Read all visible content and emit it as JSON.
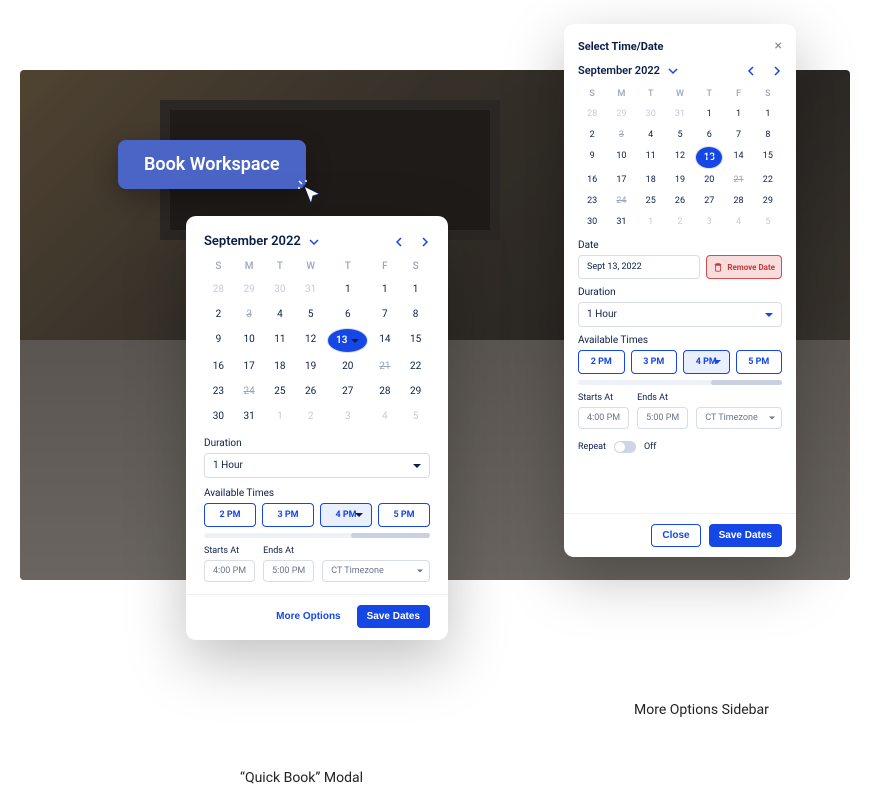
{
  "cta": {
    "label": "Book Workspace"
  },
  "calendar": {
    "month_label": "September 2022",
    "dow": [
      "S",
      "M",
      "T",
      "W",
      "T",
      "F",
      "S"
    ],
    "days": [
      {
        "n": "28",
        "cls": "muted"
      },
      {
        "n": "29",
        "cls": "muted"
      },
      {
        "n": "30",
        "cls": "muted"
      },
      {
        "n": "31",
        "cls": "muted"
      },
      {
        "n": "1",
        "cls": ""
      },
      {
        "n": "1",
        "cls": ""
      },
      {
        "n": "1",
        "cls": ""
      },
      {
        "n": "2",
        "cls": ""
      },
      {
        "n": "3",
        "cls": "strike"
      },
      {
        "n": "4",
        "cls": ""
      },
      {
        "n": "5",
        "cls": ""
      },
      {
        "n": "6",
        "cls": ""
      },
      {
        "n": "7",
        "cls": ""
      },
      {
        "n": "8",
        "cls": ""
      },
      {
        "n": "9",
        "cls": ""
      },
      {
        "n": "10",
        "cls": ""
      },
      {
        "n": "11",
        "cls": ""
      },
      {
        "n": "12",
        "cls": ""
      },
      {
        "n": "13",
        "cls": "sel"
      },
      {
        "n": "14",
        "cls": ""
      },
      {
        "n": "15",
        "cls": ""
      },
      {
        "n": "16",
        "cls": ""
      },
      {
        "n": "17",
        "cls": ""
      },
      {
        "n": "18",
        "cls": ""
      },
      {
        "n": "19",
        "cls": ""
      },
      {
        "n": "20",
        "cls": ""
      },
      {
        "n": "21",
        "cls": "strike"
      },
      {
        "n": "22",
        "cls": ""
      },
      {
        "n": "23",
        "cls": ""
      },
      {
        "n": "24",
        "cls": "strike"
      },
      {
        "n": "25",
        "cls": ""
      },
      {
        "n": "26",
        "cls": ""
      },
      {
        "n": "27",
        "cls": ""
      },
      {
        "n": "28",
        "cls": ""
      },
      {
        "n": "29",
        "cls": ""
      },
      {
        "n": "30",
        "cls": ""
      },
      {
        "n": "31",
        "cls": ""
      },
      {
        "n": "1",
        "cls": "muted"
      },
      {
        "n": "2",
        "cls": "muted"
      },
      {
        "n": "3",
        "cls": "muted"
      },
      {
        "n": "4",
        "cls": "muted"
      },
      {
        "n": "5",
        "cls": "muted"
      }
    ]
  },
  "modal": {
    "duration_label": "Duration",
    "duration_value": "1 Hour",
    "avail_label": "Available Times",
    "times": [
      "2 PM",
      "3 PM",
      "4 PM",
      "5 PM"
    ],
    "times_selected_index": 2,
    "starts_label": "Starts At",
    "ends_label": "Ends At",
    "starts_value": "4:00 PM",
    "ends_value": "5:00 PM",
    "tz_value": "CT Timezone",
    "more_label": "More Options",
    "save_label": "Save Dates"
  },
  "sidebar": {
    "title": "Select Time/Date",
    "date_label": "Date",
    "date_value": "Sept 13, 2022",
    "remove_label": "Remove Date",
    "duration_label": "Duration",
    "duration_value": "1 Hour",
    "avail_label": "Available Times",
    "times": [
      "2 PM",
      "3 PM",
      "4 PM",
      "5 PM"
    ],
    "times_selected_index": 2,
    "starts_label": "Starts At",
    "ends_label": "Ends At",
    "starts_value": "4:00 PM",
    "ends_value": "5:00 PM",
    "tz_value": "CT Timezone",
    "repeat_label": "Repeat",
    "repeat_state": "Off",
    "close_label": "Close",
    "save_label": "Save Dates"
  },
  "captions": {
    "modal": "“Quick Book” Modal",
    "sidebar": "More Options Sidebar"
  }
}
